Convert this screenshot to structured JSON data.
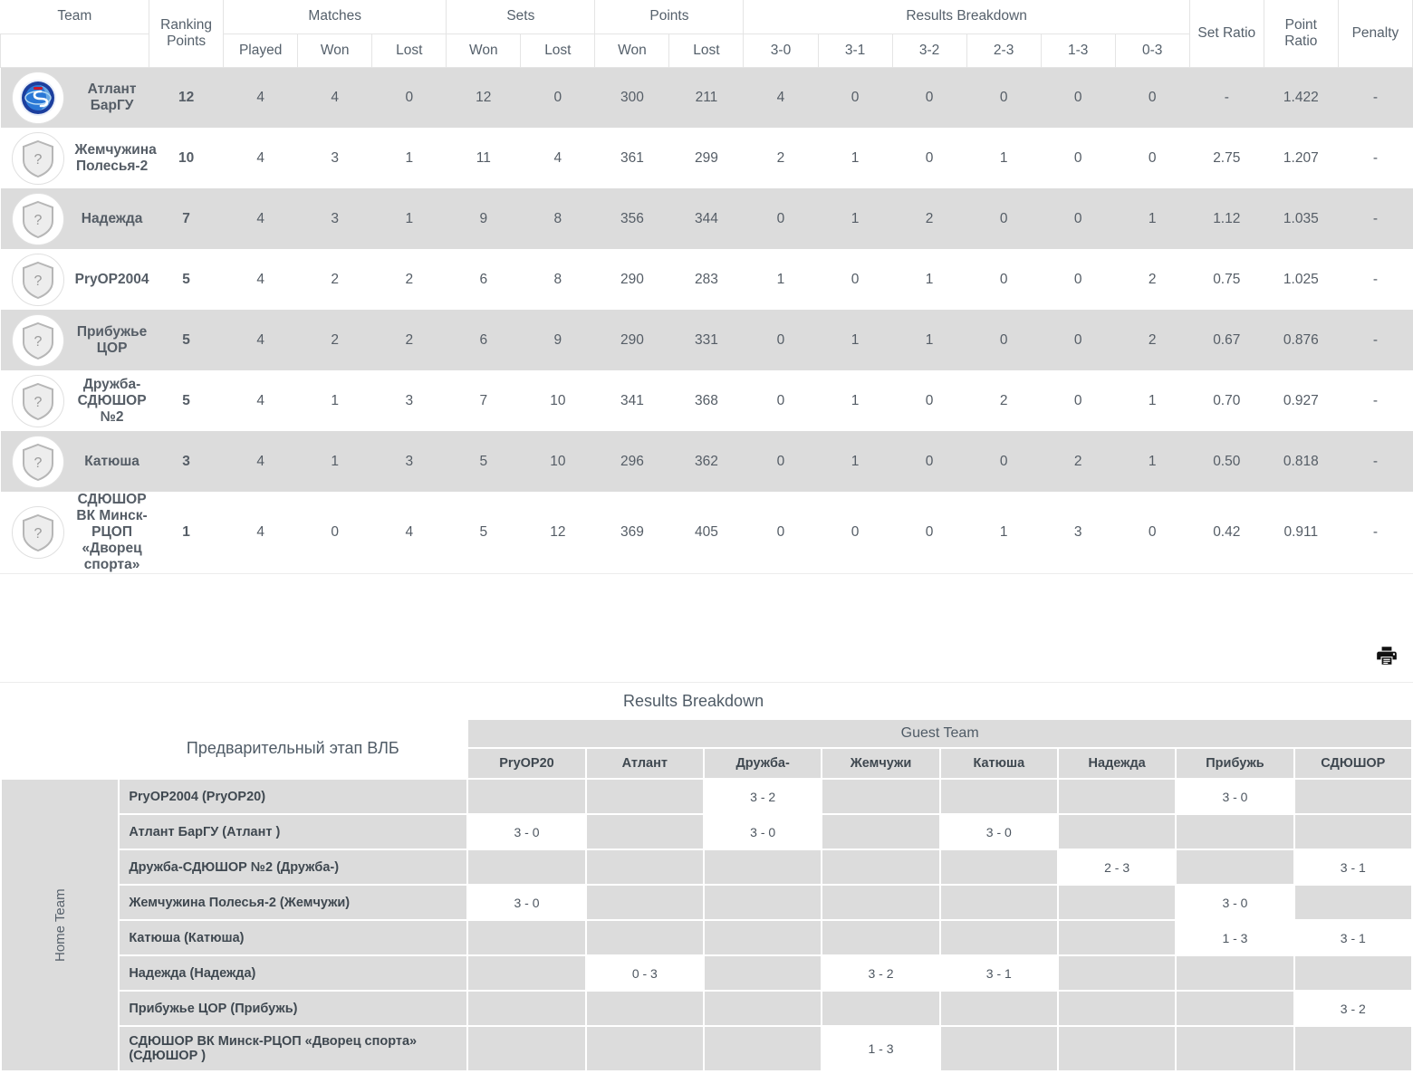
{
  "standings": {
    "headers": {
      "team": "Team",
      "ranking_points": "Ranking Points",
      "matches": "Matches",
      "sets": "Sets",
      "points": "Points",
      "results_breakdown": "Results Breakdown",
      "set_ratio": "Set Ratio",
      "point_ratio": "Point Ratio",
      "penalty": "Penalty",
      "played": "Played",
      "won": "Won",
      "lost": "Lost",
      "won2": "Won",
      "lost2": "Lost",
      "won3": "Won",
      "lost3": "Lost",
      "r30": "3-0",
      "r31": "3-1",
      "r32": "3-2",
      "r23": "2-3",
      "r13": "1-3",
      "r03": "0-3"
    },
    "rows": [
      {
        "logo": "team-crest-atlant",
        "team": "Атлант БарГУ",
        "rp": "12",
        "played": "4",
        "mwon": "4",
        "mlost": "0",
        "swon": "12",
        "slost": "0",
        "pwon": "300",
        "plost": "211",
        "r30": "4",
        "r31": "0",
        "r32": "0",
        "r23": "0",
        "r13": "0",
        "r03": "0",
        "set_ratio": "-",
        "point_ratio": "1.422",
        "penalty": "-"
      },
      {
        "logo": "shield-placeholder",
        "team": "Жемчужина Полесья-2",
        "rp": "10",
        "played": "4",
        "mwon": "3",
        "mlost": "1",
        "swon": "11",
        "slost": "4",
        "pwon": "361",
        "plost": "299",
        "r30": "2",
        "r31": "1",
        "r32": "0",
        "r23": "1",
        "r13": "0",
        "r03": "0",
        "set_ratio": "2.75",
        "point_ratio": "1.207",
        "penalty": "-"
      },
      {
        "logo": "shield-placeholder",
        "team": "Надежда",
        "rp": "7",
        "played": "4",
        "mwon": "3",
        "mlost": "1",
        "swon": "9",
        "slost": "8",
        "pwon": "356",
        "plost": "344",
        "r30": "0",
        "r31": "1",
        "r32": "2",
        "r23": "0",
        "r13": "0",
        "r03": "1",
        "set_ratio": "1.12",
        "point_ratio": "1.035",
        "penalty": "-"
      },
      {
        "logo": "shield-placeholder",
        "team": "PryOP2004",
        "rp": "5",
        "played": "4",
        "mwon": "2",
        "mlost": "2",
        "swon": "6",
        "slost": "8",
        "pwon": "290",
        "plost": "283",
        "r30": "1",
        "r31": "0",
        "r32": "1",
        "r23": "0",
        "r13": "0",
        "r03": "2",
        "set_ratio": "0.75",
        "point_ratio": "1.025",
        "penalty": "-"
      },
      {
        "logo": "shield-placeholder",
        "team": "Прибужье ЦОР",
        "rp": "5",
        "played": "4",
        "mwon": "2",
        "mlost": "2",
        "swon": "6",
        "slost": "9",
        "pwon": "290",
        "plost": "331",
        "r30": "0",
        "r31": "1",
        "r32": "1",
        "r23": "0",
        "r13": "0",
        "r03": "2",
        "set_ratio": "0.67",
        "point_ratio": "0.876",
        "penalty": "-"
      },
      {
        "logo": "shield-placeholder",
        "team": "Дружба-СДЮШОР №2",
        "rp": "5",
        "played": "4",
        "mwon": "1",
        "mlost": "3",
        "swon": "7",
        "slost": "10",
        "pwon": "341",
        "plost": "368",
        "r30": "0",
        "r31": "1",
        "r32": "0",
        "r23": "2",
        "r13": "0",
        "r03": "1",
        "set_ratio": "0.70",
        "point_ratio": "0.927",
        "penalty": "-"
      },
      {
        "logo": "shield-placeholder",
        "team": "Катюша",
        "rp": "3",
        "played": "4",
        "mwon": "1",
        "mlost": "3",
        "swon": "5",
        "slost": "10",
        "pwon": "296",
        "plost": "362",
        "r30": "0",
        "r31": "1",
        "r32": "0",
        "r23": "0",
        "r13": "2",
        "r03": "1",
        "set_ratio": "0.50",
        "point_ratio": "0.818",
        "penalty": "-"
      },
      {
        "logo": "shield-placeholder",
        "team": "СДЮШОР ВК Минск-РЦОП «Дворец спорта»",
        "rp": "1",
        "played": "4",
        "mwon": "0",
        "mlost": "4",
        "swon": "5",
        "slost": "12",
        "pwon": "369",
        "plost": "405",
        "r30": "0",
        "r31": "0",
        "r32": "0",
        "r23": "1",
        "r13": "3",
        "r03": "0",
        "set_ratio": "0.42",
        "point_ratio": "0.911",
        "penalty": "-"
      }
    ]
  },
  "toolbar": {
    "print_icon": "printer-icon"
  },
  "breakdown": {
    "title": "Results Breakdown",
    "stage": "Предварительный этап ВЛБ",
    "guest_team_label": "Guest Team",
    "home_team_label": "Home Team",
    "guest_columns": [
      "PryOP20",
      "Атлант",
      "Дружба-",
      "Жемчужи",
      "Катюша",
      "Надежда",
      "Прибужь",
      "СДЮШОР"
    ],
    "rows": [
      {
        "home": "PryOP2004 (PryOP20)",
        "cells": [
          "",
          "",
          "3 - 2",
          "",
          "",
          "",
          "3 - 0",
          ""
        ]
      },
      {
        "home": "Атлант БарГУ (Атлант )",
        "cells": [
          "3 - 0",
          "",
          "3 - 0",
          "",
          "3 - 0",
          "",
          "",
          ""
        ]
      },
      {
        "home": "Дружба-СДЮШОР №2 (Дружба-)",
        "cells": [
          "",
          "",
          "",
          "",
          "",
          "2 - 3",
          "",
          "3 - 1"
        ]
      },
      {
        "home": "Жемчужина Полесья-2 (Жемчужи)",
        "cells": [
          "3 - 0",
          "",
          "",
          "",
          "",
          "",
          "3 - 0",
          ""
        ]
      },
      {
        "home": "Катюша (Катюша)",
        "cells": [
          "",
          "",
          "",
          "",
          "",
          "",
          "1 - 3",
          "3 - 1"
        ]
      },
      {
        "home": "Надежда (Надежда)",
        "cells": [
          "",
          "0 - 3",
          "",
          "3 - 2",
          "3 - 1",
          "",
          "",
          ""
        ]
      },
      {
        "home": "Прибужье ЦОР (Прибужь)",
        "cells": [
          "",
          "",
          "",
          "",
          "",
          "",
          "",
          "3 - 2"
        ]
      },
      {
        "home": "СДЮШОР ВК Минск-РЦОП «Дворец спорта» (СДЮШОР )",
        "cells": [
          "",
          "",
          "",
          "1 - 3",
          "",
          "",
          "",
          ""
        ]
      }
    ]
  }
}
